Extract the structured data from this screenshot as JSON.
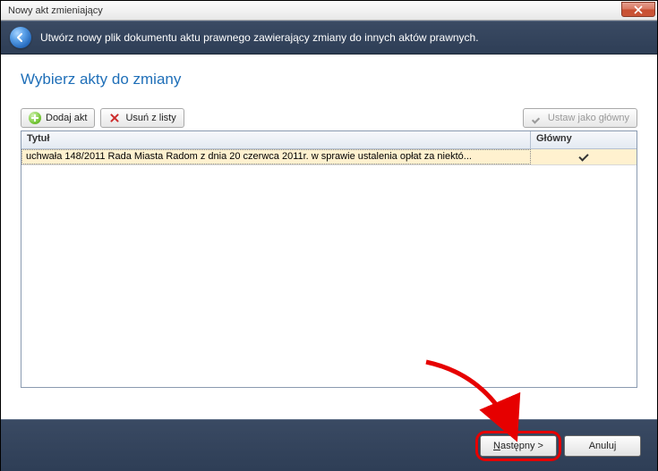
{
  "window": {
    "title": "Nowy akt zmieniający"
  },
  "banner": {
    "text": "Utwórz nowy plik dokumentu aktu prawnego zawierający zmiany do innych aktów prawnych."
  },
  "heading": "Wybierz akty do zmiany",
  "toolbar": {
    "add_label": "Dodaj akt",
    "remove_label": "Usuń z listy",
    "set_main_label": "Ustaw jako główny"
  },
  "grid": {
    "columns": {
      "title": "Tytuł",
      "main": "Główny"
    },
    "rows": [
      {
        "title": "uchwała 148/2011 Rada Miasta Radom z dnia 20 czerwca 2011r. w sprawie ustalenia opłat za niektó...",
        "main": true
      }
    ]
  },
  "footer": {
    "next_prefix": "N",
    "next_rest": "astępny >",
    "cancel": "Anuluj"
  }
}
